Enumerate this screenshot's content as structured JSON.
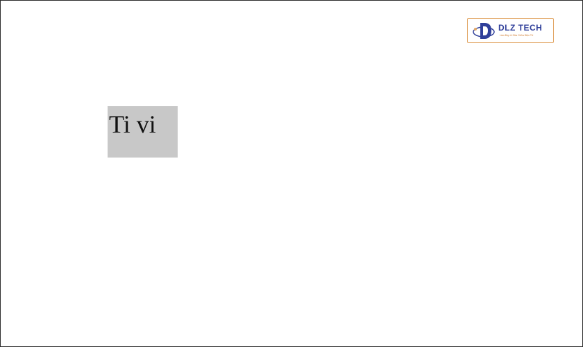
{
  "cell": {
    "text": "Ti vi",
    "background": "#c8c8c8"
  },
  "logo": {
    "name": "DLZ TECH",
    "tagline": "Làm Đẹp & Sửa Chữa Điện Tử",
    "icon": "dlz-logo-mark",
    "colors": {
      "primary": "#2f3f9a",
      "accent": "#e2a766"
    }
  }
}
